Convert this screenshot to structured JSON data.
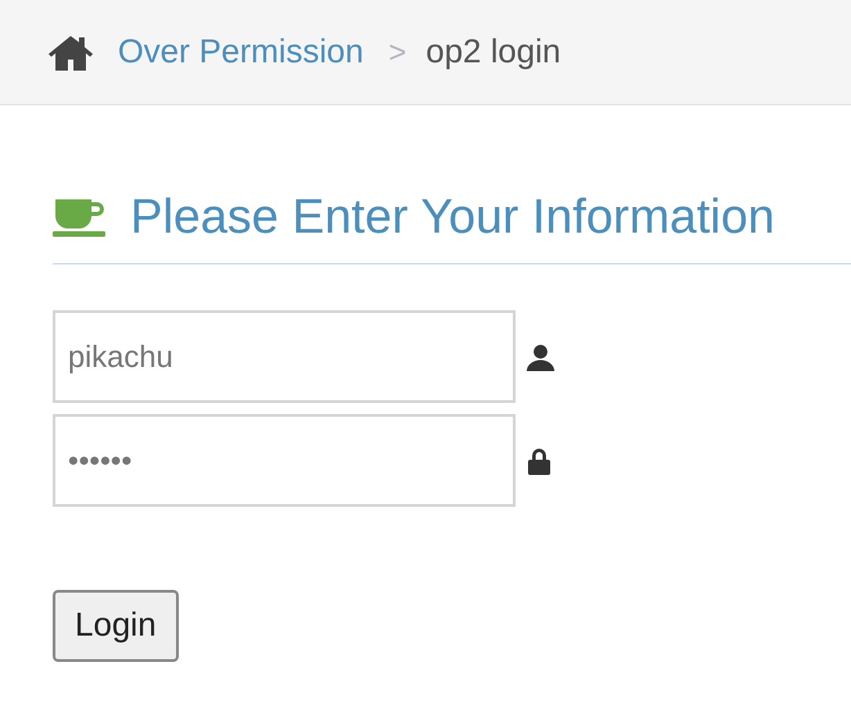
{
  "breadcrumb": {
    "items": [
      {
        "label": "Over Permission",
        "kind": "link"
      },
      {
        "label": "op2 login",
        "kind": "current"
      }
    ],
    "separator": ">"
  },
  "heading": "Please Enter Your Information",
  "fields": [
    {
      "value": "pikachu",
      "kind": "user"
    },
    {
      "value": "••••••",
      "kind": "lock"
    }
  ],
  "buttons": [
    "Login"
  ]
}
